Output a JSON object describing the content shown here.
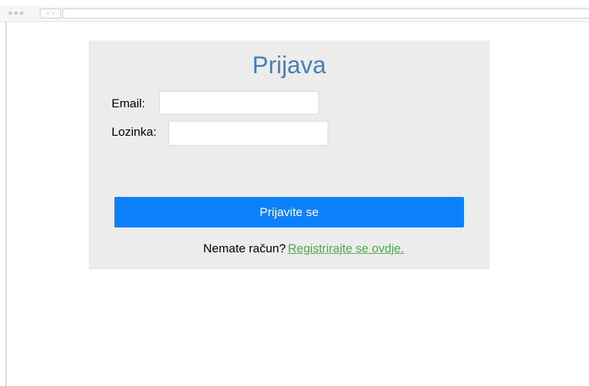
{
  "browser": {
    "back_glyph": "‹",
    "forward_glyph": "›"
  },
  "login": {
    "title": "Prijava",
    "email_label": "Email:",
    "email_value": "",
    "password_label": "Lozinka:",
    "password_value": "",
    "submit_label": "Prijavite se",
    "no_account_text": "Nemate račun?",
    "register_link": "Registrirajte se ovdje."
  },
  "colors": {
    "title": "#4a7fb5",
    "panel_bg": "#ececec",
    "button_bg": "#0d80fb",
    "link": "#49a94a"
  }
}
